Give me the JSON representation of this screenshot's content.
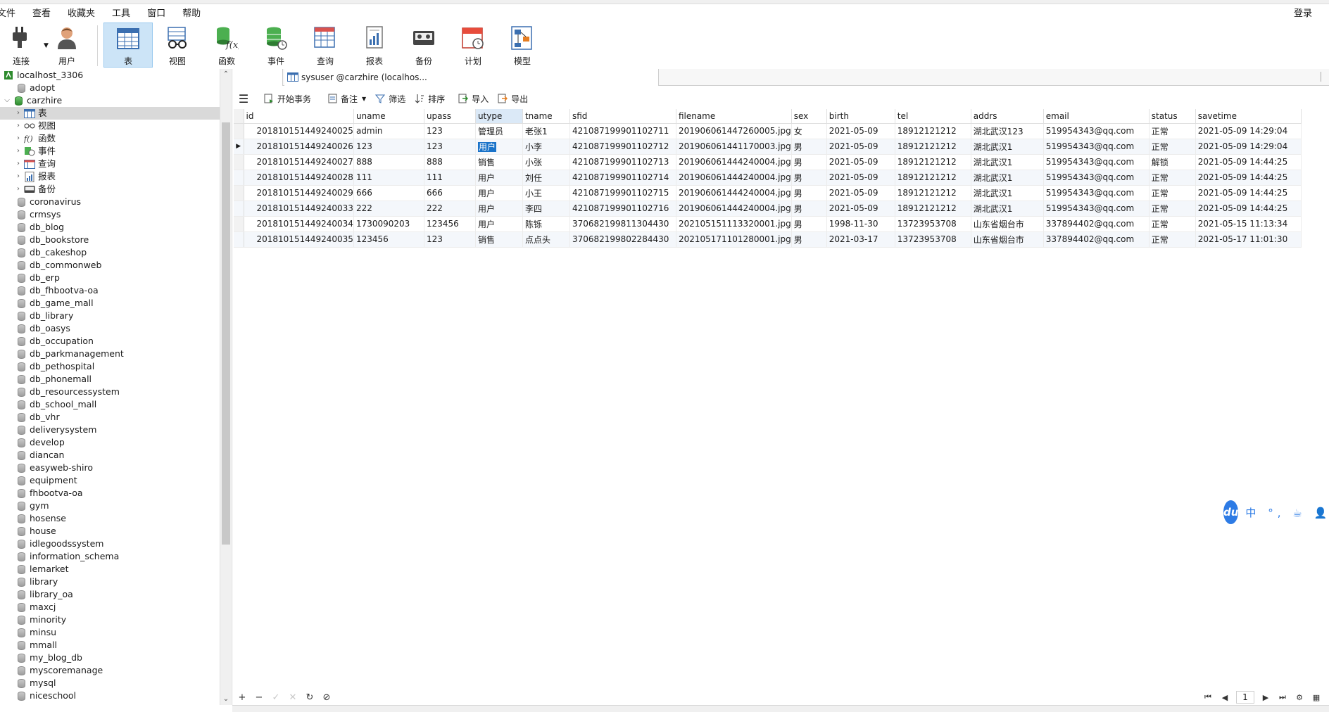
{
  "menu": {
    "items": [
      "文件",
      "查看",
      "收藏夹",
      "工具",
      "窗口",
      "帮助"
    ],
    "login": "登录"
  },
  "toolbar": {
    "tools": [
      {
        "label": "连接",
        "icon": "plug-icon"
      },
      {
        "label": "用户",
        "icon": "user-icon"
      },
      {
        "label": "表",
        "icon": "table-icon"
      },
      {
        "label": "视图",
        "icon": "view-glasses-icon"
      },
      {
        "label": "函数",
        "icon": "function-icon"
      },
      {
        "label": "事件",
        "icon": "event-icon"
      },
      {
        "label": "查询",
        "icon": "query-icon"
      },
      {
        "label": "报表",
        "icon": "report-icon"
      },
      {
        "label": "备份",
        "icon": "backup-icon"
      },
      {
        "label": "计划",
        "icon": "schedule-icon"
      },
      {
        "label": "模型",
        "icon": "model-icon"
      }
    ],
    "active": "表"
  },
  "tab": {
    "title": "sysuser @carzhire (localhos..."
  },
  "sidebar": {
    "connection": "localhost_3306",
    "adopt": "adopt",
    "open_db": "carzhire",
    "open_children": [
      {
        "label": "表",
        "icon": "table-icon"
      },
      {
        "label": "视图",
        "icon": "view-glasses-icon"
      },
      {
        "label": "函数",
        "icon": "function-icon"
      },
      {
        "label": "事件",
        "icon": "event-icon"
      },
      {
        "label": "查询",
        "icon": "query-icon"
      },
      {
        "label": "报表",
        "icon": "report-icon"
      },
      {
        "label": "备份",
        "icon": "backup-icon"
      }
    ],
    "databases": [
      "coronavirus",
      "crmsys",
      "db_blog",
      "db_bookstore",
      "db_cakeshop",
      "db_commonweb",
      "db_erp",
      "db_fhbootva-oa",
      "db_game_mall",
      "db_library",
      "db_oasys",
      "db_occupation",
      "db_parkmanagement",
      "db_pethospital",
      "db_phonemall",
      "db_resourcessystem",
      "db_school_mall",
      "db_vhr",
      "deliverysystem",
      "develop",
      "diancan",
      "easyweb-shiro",
      "equipment",
      "fhbootva-oa",
      "gym",
      "hosense",
      "house",
      "idlegoodssystem",
      "information_schema",
      "lemarket",
      "library",
      "library_oa",
      "maxcj",
      "minority",
      "minsu",
      "mmall",
      "my_blog_db",
      "myscoremanage",
      "mysql",
      "niceschool"
    ]
  },
  "gridbar": {
    "begin_transaction": "开始事务",
    "note": "备注",
    "filter": "筛选",
    "sort": "排序",
    "import": "导入",
    "export": "导出"
  },
  "grid": {
    "columns": [
      "id",
      "uname",
      "upass",
      "utype",
      "tname",
      "sfid",
      "filename",
      "sex",
      "birth",
      "tel",
      "addrs",
      "email",
      "status",
      "savetime"
    ],
    "selected_column": "utype",
    "rows": [
      [
        "201810151449240025",
        "admin",
        "123",
        "管理员",
        "老张1",
        "421087199901102711",
        "201906061447260005.jpg",
        "女",
        "2021-05-09",
        "18912121212",
        "湖北武汉123",
        "519954343@qq.com",
        "正常",
        "2021-05-09 14:29:04"
      ],
      [
        "201810151449240026",
        "123",
        "123",
        "用户",
        "小李",
        "421087199901102712",
        "201906061441170003.jpg",
        "男",
        "2021-05-09",
        "18912121212",
        "湖北武汉1",
        "519954343@qq.com",
        "正常",
        "2021-05-09 14:29:04"
      ],
      [
        "201810151449240027",
        "888",
        "888",
        "销售",
        "小张",
        "421087199901102713",
        "201906061444240004.jpg",
        "男",
        "2021-05-09",
        "18912121212",
        "湖北武汉1",
        "519954343@qq.com",
        "解锁",
        "2021-05-09 14:44:25"
      ],
      [
        "201810151449240028",
        "111",
        "111",
        "用户",
        "刘任",
        "421087199901102714",
        "201906061444240004.jpg",
        "男",
        "2021-05-09",
        "18912121212",
        "湖北武汉1",
        "519954343@qq.com",
        "正常",
        "2021-05-09 14:44:25"
      ],
      [
        "201810151449240029",
        "666",
        "666",
        "用户",
        "小王",
        "421087199901102715",
        "201906061444240004.jpg",
        "男",
        "2021-05-09",
        "18912121212",
        "湖北武汉1",
        "519954343@qq.com",
        "正常",
        "2021-05-09 14:44:25"
      ],
      [
        "201810151449240033",
        "222",
        "222",
        "用户",
        "李四",
        "421087199901102716",
        "201906061444240004.jpg",
        "男",
        "2021-05-09",
        "18912121212",
        "湖北武汉1",
        "519954343@qq.com",
        "正常",
        "2021-05-09 14:44:25"
      ],
      [
        "201810151449240034",
        "1730090203",
        "123456",
        "用户",
        "陈铄",
        "370682199811304430",
        "202105151113320001.jpg",
        "男",
        "1998-11-30",
        "13723953708",
        "山东省烟台市",
        "337894402@qq.com",
        "正常",
        "2021-05-15 11:13:34"
      ],
      [
        "201810151449240035",
        "123456",
        "123",
        "销售",
        "点点头",
        "370682199802284430",
        "202105171101280001.jpg",
        "男",
        "2021-03-17",
        "13723953708",
        "山东省烟台市",
        "337894402@qq.com",
        "正常",
        "2021-05-17 11:01:30"
      ]
    ],
    "current_row": 1
  },
  "pager": {
    "page": "1"
  },
  "ime": {
    "logo": "du",
    "text": "中 °, ☕ 👤"
  },
  "colors": {
    "accent": "#1a73c9",
    "active_tool_bg": "#cce4f7",
    "ime_blue": "#2d7be5"
  }
}
